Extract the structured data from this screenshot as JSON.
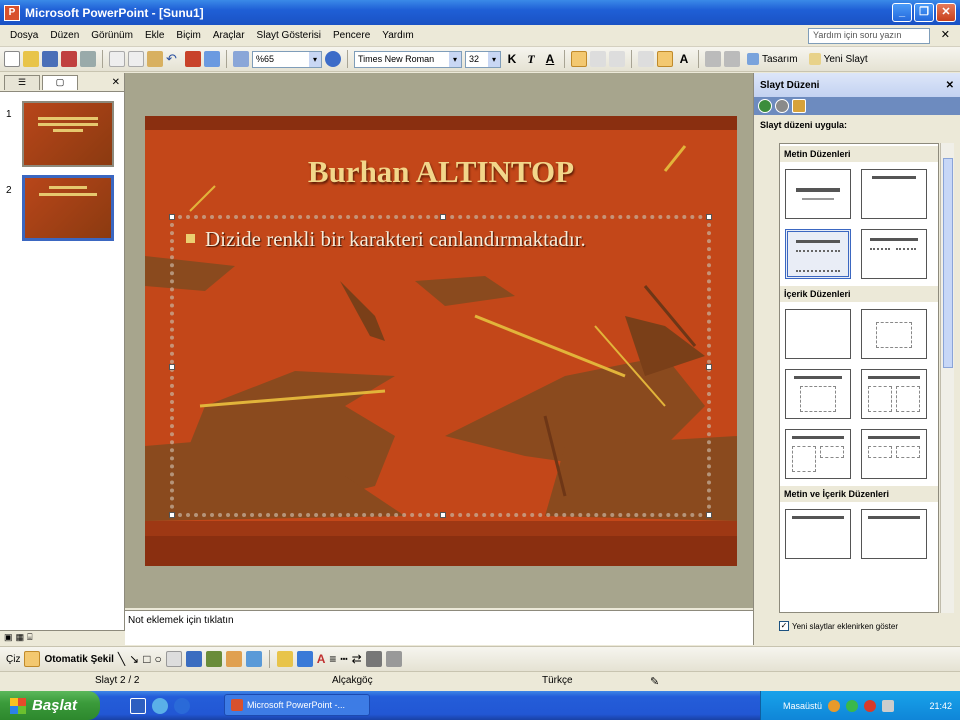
{
  "window": {
    "title": "Microsoft PowerPoint - [Sunu1]",
    "app_icon_letter": "P"
  },
  "menu": {
    "items": [
      "Dosya",
      "Düzen",
      "Görünüm",
      "Ekle",
      "Biçim",
      "Araçlar",
      "Slayt Gösterisi",
      "Pencere",
      "Yardım"
    ],
    "help_placeholder": "Yardım için soru yazın"
  },
  "toolbar": {
    "zoom": "%65",
    "font_name": "Times New Roman",
    "font_size": "32",
    "bold_label": "K",
    "italic_label": "T",
    "underline_label": "A",
    "design_label": "Tasarım",
    "new_slide_label": "Yeni Slayt"
  },
  "slides_panel": {
    "thumbnails": [
      {
        "number": "1"
      },
      {
        "number": "2"
      }
    ]
  },
  "slide": {
    "title": "Burhan ALTINTOP",
    "bullet": "Dizide renkli bir karakteri canlandırmaktadır."
  },
  "notes": {
    "placeholder": "Not eklemek için tıklatın"
  },
  "task_pane": {
    "title": "Slayt Düzeni",
    "apply_label": "Slayt düzeni uygula:",
    "sections": [
      "Metin Düzenleri",
      "İçerik Düzenleri",
      "Metin ve İçerik Düzenleri"
    ],
    "checkbox_label": "Yeni slaytlar eklenirken göster"
  },
  "drawing": {
    "draw_label": "Çiz",
    "autoshapes_label": "Otomatik Şekil"
  },
  "status": {
    "slide_info": "Slayt 2 / 2",
    "design": "Alçakgöç",
    "language": "Türkçe"
  },
  "taskbar": {
    "start_label": "Başlat",
    "task_label": "Microsoft PowerPoint -...",
    "tray_text": "Masaüstü",
    "clock": "21:42"
  },
  "colors": {
    "slide_bg": "#c34719",
    "title_color": "#f2d68a",
    "accent_blue": "#1f5fd6"
  }
}
